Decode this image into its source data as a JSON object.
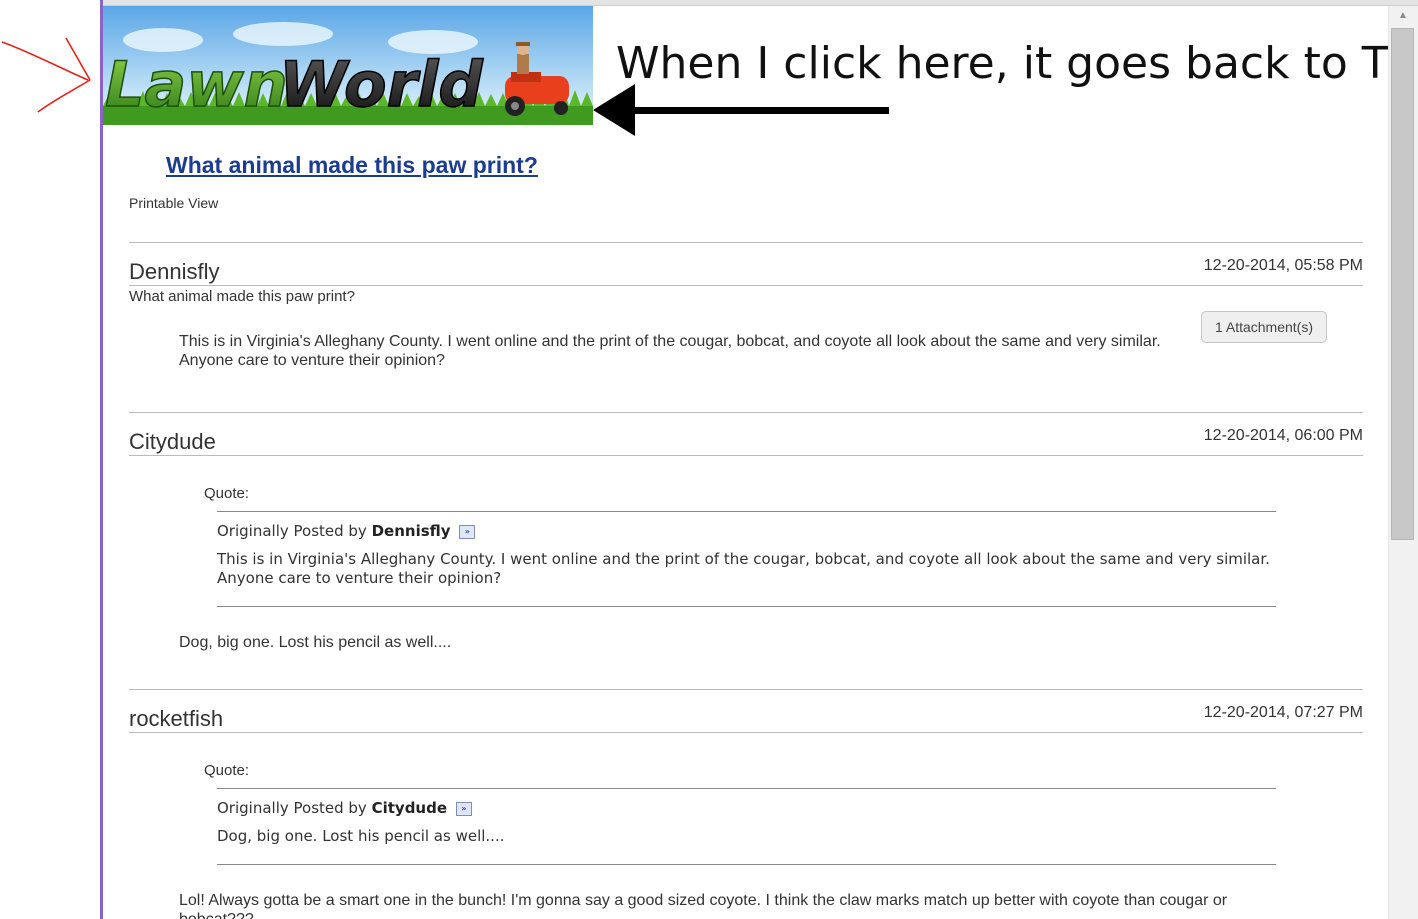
{
  "annotation": {
    "note": "When I click here, it goes back to TBN"
  },
  "banner": {
    "logo_text": "LawnWorld"
  },
  "thread": {
    "title": "What animal made this paw print?",
    "printable_view": "Printable View"
  },
  "posts": [
    {
      "author": "Dennisfly",
      "date": "12-20-2014, 05:58 PM",
      "subtitle": "What animal made this paw print?",
      "attachment_label": "1 Attachment(s)",
      "body": "This is in Virginia's Alleghany County. I went online and the print of the cougar, bobcat, and coyote all look about the same and very similar. Anyone care to venture their opinion?"
    },
    {
      "author": "Citydude",
      "date": "12-20-2014, 06:00 PM",
      "quote_label": "Quote:",
      "quote_prefix": "Originally Posted by",
      "quote_author": "Dennisfly",
      "quote_text": "This is in Virginia's Alleghany County. I went online and the print of the cougar, bobcat, and coyote all look about the same and very similar. Anyone care to venture their opinion?",
      "body": "Dog, big one. Lost his pencil as well...."
    },
    {
      "author": "rocketfish",
      "date": "12-20-2014, 07:27 PM",
      "quote_label": "Quote:",
      "quote_prefix": "Originally Posted by",
      "quote_author": "Citydude",
      "quote_text": "Dog, big one. Lost his pencil as well....",
      "body": "Lol! Always gotta be a smart one in the bunch! I'm gonna say a good sized coyote. I think the claw marks match up better with coyote than cougar or bobcat???"
    }
  ],
  "icons": {
    "view_post": "view-post-icon",
    "scroll_up": "scroll-up-arrow-icon",
    "red_arrow": "red-arrow-icon",
    "black_arrow": "black-arrow-icon"
  },
  "colors": {
    "title_link": "#1a3d8f",
    "frame": "#8a63c9",
    "red_annotation": "#e0231c"
  }
}
